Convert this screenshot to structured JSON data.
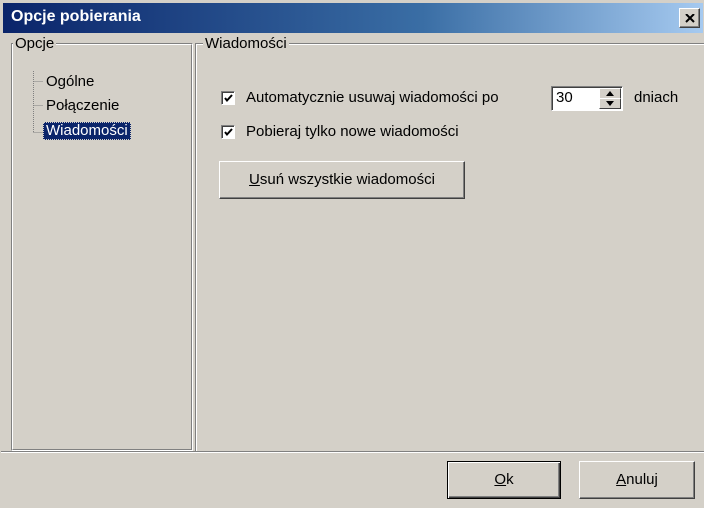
{
  "window": {
    "title": "Opcje pobierania"
  },
  "tree": {
    "group_label": "Opcje",
    "items": [
      {
        "label": "Ogólne",
        "selected": false
      },
      {
        "label": "Połączenie",
        "selected": false
      },
      {
        "label": "Wiadomości",
        "selected": true
      }
    ]
  },
  "messages_group": {
    "group_label": "Wiadomości",
    "auto_delete": {
      "checked": true,
      "label_before": "Automatycznie usuwaj wiadomości po",
      "days_value": "30",
      "label_after": "dniach"
    },
    "new_only": {
      "checked": true,
      "label": "Pobieraj tylko nowe wiadomości"
    },
    "delete_all_button": {
      "accel": "U",
      "rest": "suń wszystkie wiadomości"
    }
  },
  "footer": {
    "ok_button": {
      "accel": "O",
      "rest": "k"
    },
    "cancel_button": {
      "accel": "A",
      "rest": "nuluj"
    }
  },
  "icons": {
    "close": "close-icon",
    "check": "checkmark-icon",
    "spin_up": "arrow-up-icon",
    "spin_down": "arrow-down-icon"
  },
  "colors": {
    "title_gradient_start": "#0a246a",
    "title_gradient_end": "#a6caf0",
    "face": "#d4d0c8",
    "selection": "#0a246a"
  }
}
